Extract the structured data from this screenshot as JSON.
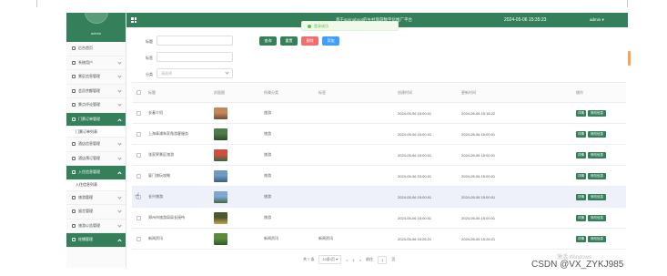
{
  "app": {
    "title": "基于springboot的乡村旅游数字化推广平台",
    "datetime": "2024-05-06 15:35:23",
    "user": "admin"
  },
  "toast": {
    "text": "登录成功"
  },
  "sidebar": {
    "admin_label": "admin",
    "items": [
      {
        "label": "后台首页",
        "icon": "home-icon",
        "arrow": false
      },
      {
        "label": "系统用户",
        "icon": "user-icon",
        "arrow": true
      },
      {
        "label": "景区信息管理",
        "icon": "doc-icon",
        "arrow": true
      },
      {
        "label": "会员余额管理",
        "icon": "doc-icon",
        "arrow": true
      },
      {
        "label": "景点评论管理",
        "icon": "doc-icon",
        "arrow": true
      },
      {
        "label": "门票订单管理",
        "icon": "doc-icon",
        "arrow": true,
        "active": true,
        "sub": [
          "门票订单列表"
        ]
      },
      {
        "label": "酒店信息管理",
        "icon": "doc-icon",
        "arrow": true
      },
      {
        "label": "酒店预订管理",
        "icon": "doc-icon",
        "arrow": true
      },
      {
        "label": "入住信息管理",
        "icon": "doc-icon",
        "arrow": true,
        "active": true,
        "sub": [
          "入住信息列表"
        ]
      },
      {
        "label": "旅游管理",
        "icon": "doc-icon",
        "arrow": true
      },
      {
        "label": "留言管理",
        "icon": "doc-icon",
        "arrow": true
      },
      {
        "label": "旅游公告管理",
        "icon": "doc-icon",
        "arrow": true
      },
      {
        "label": "轮播管理",
        "icon": "gear-icon",
        "arrow": true,
        "active": true
      }
    ]
  },
  "search": {
    "label_title": "标题",
    "label_tag": "标签",
    "label_category": "分类",
    "category_placeholder": "请选择",
    "buttons": [
      {
        "label": "查询",
        "color": "#35805a"
      },
      {
        "label": "重置",
        "color": "#35805a"
      },
      {
        "label": "删除",
        "color": "#f56c6c"
      },
      {
        "label": "添加",
        "color": "#409eff"
      }
    ]
  },
  "table": {
    "columns": [
      "标题",
      "封面图",
      "所属分类",
      "标签",
      "创建时间",
      "更新时间",
      "操作"
    ],
    "rows": [
      {
        "title": "长春介绍",
        "category": "旅游",
        "tag": "",
        "created": "2024-05-06 15:00:01",
        "updated": "2024-05-06 15:18:22",
        "img": [
          "#c7865a",
          "#6b4e3a"
        ]
      },
      {
        "title": "上海青浦朱家角游客服务",
        "category": "旅游",
        "tag": "",
        "created": "2024-05-06 15:00:01",
        "updated": "2024-05-06 15:00:01",
        "img": [
          "#4f7a4a",
          "#2d4a2b"
        ]
      },
      {
        "title": "张家界景区旅游",
        "category": "旅游",
        "tag": "",
        "created": "2024-05-06 15:00:01",
        "updated": "2024-05-06 15:00:01",
        "img": [
          "#d05040",
          "#2f6d3c"
        ]
      },
      {
        "title": "厦门旅玩攻略",
        "category": "旅游",
        "tag": "",
        "created": "2024-05-06 15:00:01",
        "updated": "2024-05-06 15:00:01",
        "img": [
          "#6f9ac4",
          "#3c5f7e"
        ]
      },
      {
        "title": "长兴旅游",
        "category": "旅游",
        "tag": "",
        "created": "2024-05-06 15:00:01",
        "updated": "2024-05-06 15:00:01",
        "img": [
          "#7fa7d6",
          "#3f6b3f"
        ]
      },
      {
        "title": "郑州市旅游局局长接待",
        "category": "旅游",
        "tag": "",
        "created": "2024-05-06 15:00:01",
        "updated": "2024-05-06 15:00:01",
        "img": [
          "#4a5a2d",
          "#c9a14a"
        ]
      },
      {
        "title": "新闻资讯",
        "category": "新闻资讯",
        "tag": "新闻资讯",
        "created": "2024-05-06 15:26:21",
        "updated": "2024-05-06 15:26:21",
        "img": [
          "#5a8a3c",
          "#2e5a23"
        ]
      }
    ],
    "actions": [
      "详情",
      "修改信息"
    ]
  },
  "pagination": {
    "total": "共 7 条",
    "page_size": "10条/页",
    "prev": "<",
    "current": "1",
    "next": ">",
    "goto_label": "前往",
    "goto_value": "1",
    "page_unit": "页"
  },
  "overlay": {
    "activate_windows": "激活 Windows",
    "csdn": "CSDN @VX_ZYKJ985"
  }
}
